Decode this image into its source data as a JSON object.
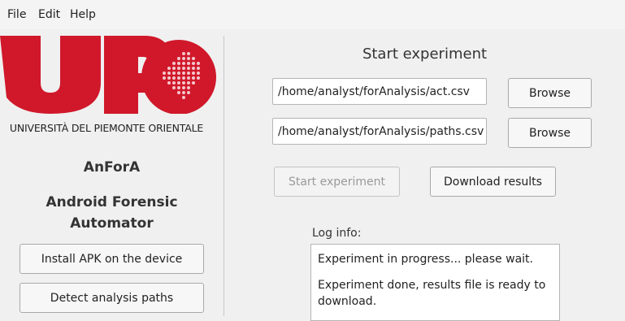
{
  "menu": {
    "file": "File",
    "edit": "Edit",
    "help": "Help"
  },
  "logo": {
    "letters": "UP",
    "university": "UNIVERSITÀ DEL PIEMONTE ORIENTALE",
    "brand_color": "#d0182a"
  },
  "sidebar": {
    "app_short": "AnForA",
    "app_full_line1": "Android Forensic",
    "app_full_line2": "Automator",
    "install_button": "Install APK on the device",
    "detect_button": "Detect analysis paths"
  },
  "main": {
    "title": "Start experiment",
    "act_path": "/home/analyst/forAnalysis/act.csv",
    "paths_path": "/home/analyst/forAnalysis/paths.csv",
    "browse_label": "Browse",
    "start_button": "Start experiment",
    "download_button": "Download results",
    "log_label": "Log info:",
    "log_lines": [
      "Experiment in progress... please wait.",
      "Experiment done, results file is ready to download."
    ]
  }
}
